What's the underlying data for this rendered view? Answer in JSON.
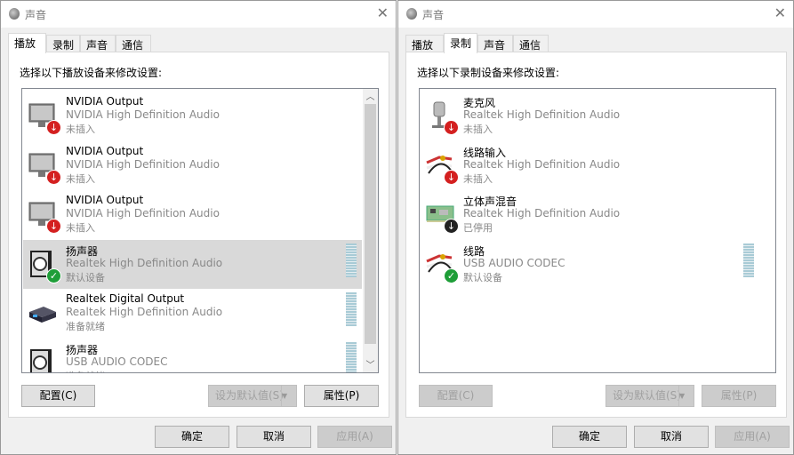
{
  "windows": [
    {
      "title": "声音",
      "tabs": [
        "播放",
        "录制",
        "声音",
        "通信"
      ],
      "active_tab": 0,
      "instruction": "选择以下播放设备来修改设置:",
      "devices": [
        {
          "name": "NVIDIA Output",
          "driver": "NVIDIA High Definition Audio",
          "status": "未插入",
          "icon": "monitor-icon",
          "badge": "unplugged",
          "selected": false,
          "meter": false
        },
        {
          "name": "NVIDIA Output",
          "driver": "NVIDIA High Definition Audio",
          "status": "未插入",
          "icon": "monitor-icon",
          "badge": "unplugged",
          "selected": false,
          "meter": false
        },
        {
          "name": "NVIDIA Output",
          "driver": "NVIDIA High Definition Audio",
          "status": "未插入",
          "icon": "monitor-icon",
          "badge": "unplugged",
          "selected": false,
          "meter": false
        },
        {
          "name": "扬声器",
          "driver": "Realtek High Definition Audio",
          "status": "默认设备",
          "icon": "speaker-icon",
          "badge": "default",
          "selected": true,
          "meter": true
        },
        {
          "name": "Realtek Digital Output",
          "driver": "Realtek High Definition Audio",
          "status": "准备就绪",
          "icon": "digital-output-icon",
          "badge": "",
          "selected": false,
          "meter": true
        },
        {
          "name": "扬声器",
          "driver": "USB AUDIO  CODEC",
          "status": "准备就绪",
          "icon": "speaker-icon",
          "badge": "",
          "selected": false,
          "meter": true
        }
      ],
      "scrollbar": true,
      "configure": "配置(C)",
      "configure_disabled": false,
      "set_default": "设为默认值(S)",
      "properties": "属性(P)",
      "properties_disabled": false,
      "ok": "确定",
      "cancel": "取消",
      "apply": "应用(A)"
    },
    {
      "title": "声音",
      "tabs": [
        "播放",
        "录制",
        "声音",
        "通信"
      ],
      "active_tab": 1,
      "instruction": "选择以下录制设备来修改设置:",
      "devices": [
        {
          "name": "麦克风",
          "driver": "Realtek High Definition Audio",
          "status": "未插入",
          "icon": "microphone-icon",
          "badge": "unplugged",
          "selected": false,
          "meter": false
        },
        {
          "name": "线路输入",
          "driver": "Realtek High Definition Audio",
          "status": "未插入",
          "icon": "line-in-icon",
          "badge": "unplugged",
          "selected": false,
          "meter": false
        },
        {
          "name": "立体声混音",
          "driver": "Realtek High Definition Audio",
          "status": "已停用",
          "icon": "sound-card-icon",
          "badge": "disabled",
          "selected": false,
          "meter": false
        },
        {
          "name": "线路",
          "driver": "USB AUDIO  CODEC",
          "status": "默认设备",
          "icon": "line-in-icon",
          "badge": "default",
          "selected": false,
          "meter": true
        }
      ],
      "scrollbar": false,
      "configure": "配置(C)",
      "configure_disabled": true,
      "set_default": "设为默认值(S)",
      "properties": "属性(P)",
      "properties_disabled": true,
      "ok": "确定",
      "cancel": "取消",
      "apply": "应用(A)"
    }
  ],
  "colors": {
    "default_badge": "#1e9e38",
    "unplugged_badge": "#d42020",
    "disabled_badge": "#222222",
    "selected_row": "#d9d9d9"
  }
}
